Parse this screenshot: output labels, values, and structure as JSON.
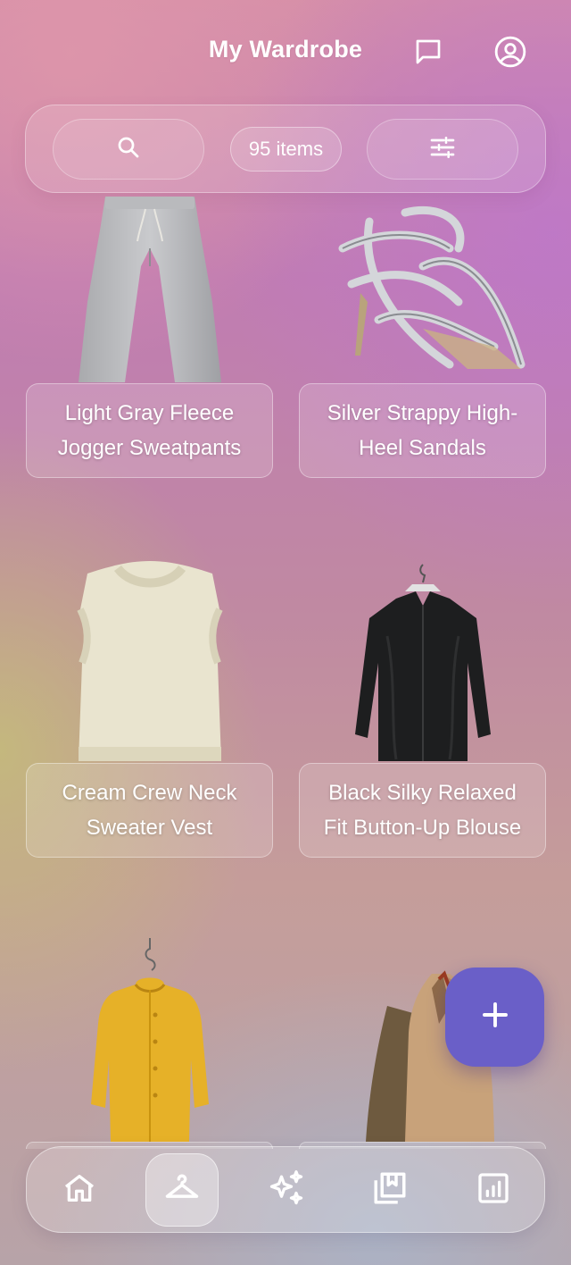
{
  "header": {
    "title": "My Wardrobe",
    "chat_icon": "chat-bubble-icon",
    "profile_icon": "account-circle-icon"
  },
  "toolbar": {
    "search_icon": "search-icon",
    "item_count": "95 items",
    "filter_icon": "tune-sliders-icon"
  },
  "items": [
    {
      "name": "Light Gray Fleece Jogger Sweatpants",
      "image": "gray-sweatpants"
    },
    {
      "name": "Silver Strappy High-Heel Sandals",
      "image": "silver-sandals"
    },
    {
      "name": "Cream Crew Neck Sweater Vest",
      "image": "cream-sweater-vest"
    },
    {
      "name": "Black Silky Relaxed Fit Button-Up Blouse",
      "image": "black-blouse"
    },
    {
      "name": "",
      "image": "yellow-raincoat"
    },
    {
      "name": "",
      "image": "tan-jacket"
    }
  ],
  "fab": {
    "icon": "plus-icon"
  },
  "bottom_nav": {
    "items": [
      {
        "icon": "home-icon",
        "active": false
      },
      {
        "icon": "hanger-icon",
        "active": true
      },
      {
        "icon": "sparkles-icon",
        "active": false
      },
      {
        "icon": "bookmarks-icon",
        "active": false
      },
      {
        "icon": "bar-chart-icon",
        "active": false
      }
    ]
  },
  "colors": {
    "fab": "#6a5fc8",
    "text": "#ffffff"
  }
}
